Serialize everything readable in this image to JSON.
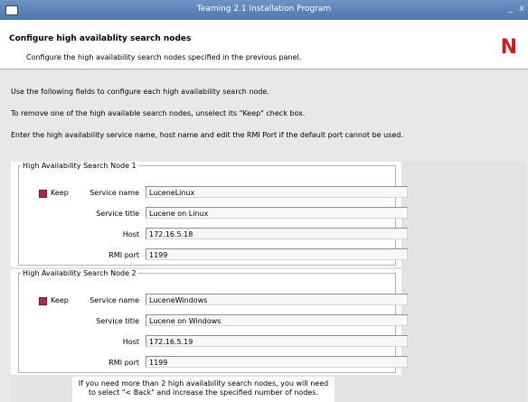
{
  "window": {
    "title": "Teaming 2.1 Installation Program",
    "minimize_glyph": "_",
    "close_glyph": "x"
  },
  "header": {
    "title": "Configure high availablity search nodes",
    "subtitle": "Configure the high availability search nodes specified in the previous panel.",
    "logo_text": "N",
    "logo_color": "#d51c1c"
  },
  "instructions": [
    "Use the following fields to configure each high availability search node.",
    "To remove one of the high available search nodes, unselect its \"Keep\" check box.",
    "Enter the high availability service name, host name and edit the RMI Port if the default port cannot be used."
  ],
  "labels": {
    "keep": "Keep",
    "service_name": "Service name",
    "service_title": "Service title",
    "host": "Host",
    "rmi_port": "RMI port"
  },
  "nodes": [
    {
      "legend": "High Availability Search Node 1",
      "keep_checked": true,
      "service_name": "LuceneLinux",
      "service_title": "Lucene on Linux",
      "host": "172.16.5.18",
      "rmi_port": "1199"
    },
    {
      "legend": "High Availability Search Node 2",
      "keep_checked": true,
      "service_name": "LuceneWindows",
      "service_title": "Lucene on Windows",
      "host": "172.16.5.19",
      "rmi_port": "1199"
    }
  ],
  "note": {
    "line1": "If you need more than 2 high availability search nodes, you will need",
    "line2": "to select \"< Back\" and increase the specified number of nodes."
  }
}
